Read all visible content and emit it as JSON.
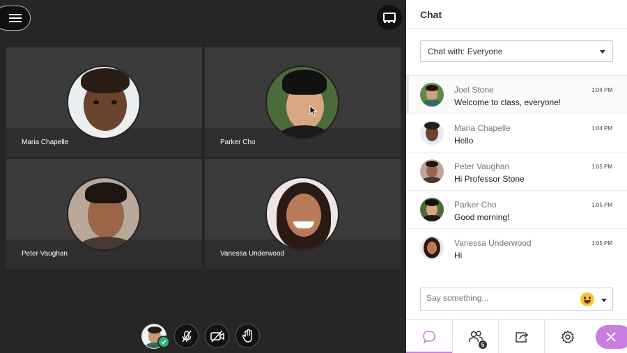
{
  "stage": {
    "tiles": [
      {
        "name": "Maria Chapelle"
      },
      {
        "name": "Parker Cho"
      },
      {
        "name": "Peter Vaughan"
      },
      {
        "name": "Vanessa Underwood"
      }
    ],
    "icons": {
      "menu": "hamburger-icon",
      "layout": "layout-icon",
      "mic": "microphone-muted-icon",
      "camera": "camera-off-icon",
      "hand": "raise-hand-icon",
      "status": "checkmark-icon"
    }
  },
  "chat": {
    "title": "Chat",
    "chat_with": "Chat with: Everyone",
    "messages": [
      {
        "author": "Joel Stone",
        "time": "1:04 PM",
        "text": "Welcome to class, everyone!"
      },
      {
        "author": "Maria Chapelle",
        "time": "1:04 PM",
        "text": "Hello"
      },
      {
        "author": "Peter Vaughan",
        "time": "1:05 PM",
        "text": "Hi Professor Stone"
      },
      {
        "author": "Parker Cho",
        "time": "1:05 PM",
        "text": "Good morning!"
      },
      {
        "author": "Vanessa Underwood",
        "time": "1:05 PM",
        "text": "Hi"
      }
    ],
    "compose_placeholder": "Say something...",
    "tabs": {
      "chat_icon": "chat-bubble-icon",
      "attendees_icon": "attendees-icon",
      "attendees_count": "5",
      "share_icon": "share-icon",
      "settings_icon": "gear-icon",
      "close_icon": "close-icon"
    }
  },
  "colors": {
    "accent": "#c87ee0",
    "stage_bg": "#262626",
    "tile_bg": "#3b3b3b",
    "status_green": "#2bb673"
  }
}
